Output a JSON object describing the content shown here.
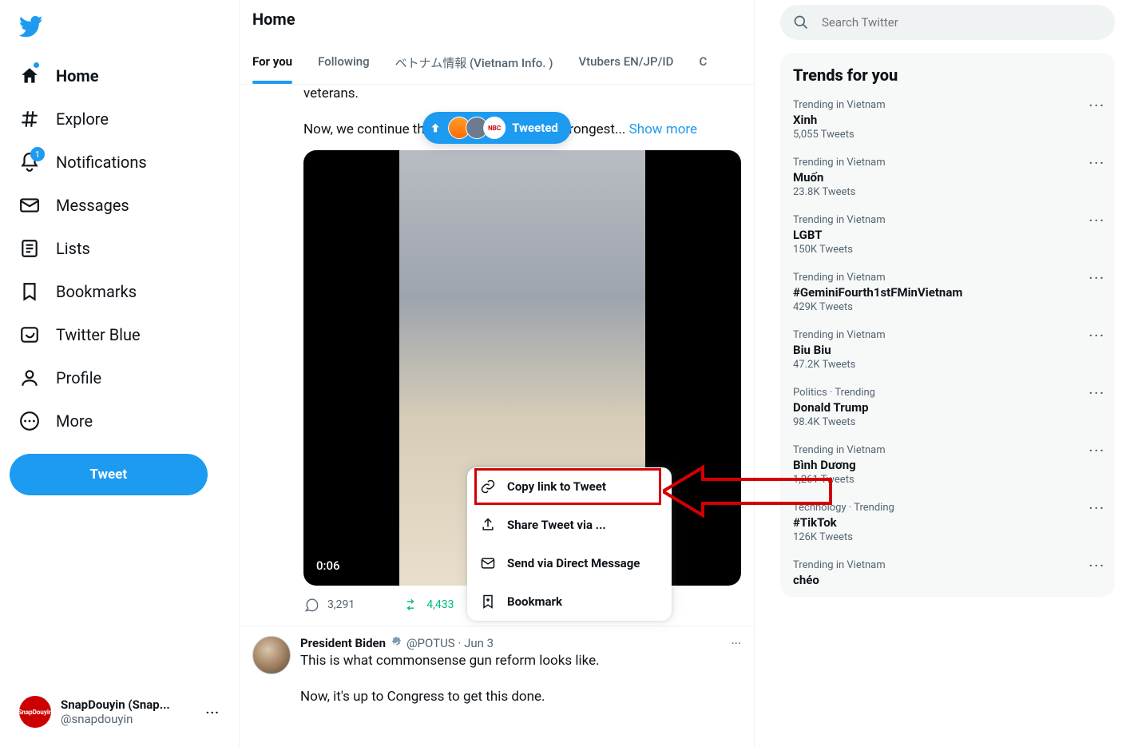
{
  "sidebar": {
    "items": [
      {
        "label": "Home"
      },
      {
        "label": "Explore"
      },
      {
        "label": "Notifications",
        "badge": "1"
      },
      {
        "label": "Messages"
      },
      {
        "label": "Lists"
      },
      {
        "label": "Bookmarks"
      },
      {
        "label": "Twitter Blue"
      },
      {
        "label": "Profile"
      },
      {
        "label": "More"
      }
    ],
    "tweet_button": "Tweet"
  },
  "account": {
    "name": "SnapDouyin (Snap...",
    "handle": "@snapdouyin"
  },
  "main": {
    "title": "Home",
    "tabs": [
      "For you",
      "Following",
      "ベトナム情報 (Vietnam Info. )",
      "Vtubers EN/JP/ID",
      "C"
    ],
    "pill_label": "Tweeted",
    "tweet1": {
      "line1_tail": "veterans.",
      "line2": "Now, we continue the work of building the strongest...",
      "show_more": "Show more",
      "video_time": "0:06",
      "reply_count": "3,291",
      "retweet_count": "4,433"
    },
    "tweet2": {
      "name": "President Biden",
      "handle": "@POTUS",
      "date": "Jun 3",
      "line1": "This is what commonsense gun reform looks like.",
      "line2": "Now, it's up to Congress to get this done."
    }
  },
  "share_menu": {
    "items": [
      "Copy link to Tweet",
      "Share Tweet via ...",
      "Send via Direct Message",
      "Bookmark"
    ]
  },
  "search": {
    "placeholder": "Search Twitter"
  },
  "trends": {
    "title": "Trends for you",
    "items": [
      {
        "ctx": "Trending in Vietnam",
        "name": "Xinh",
        "count": "5,055 Tweets"
      },
      {
        "ctx": "Trending in Vietnam",
        "name": "Muốn",
        "count": "23.8K Tweets"
      },
      {
        "ctx": "Trending in Vietnam",
        "name": "LGBT",
        "count": "150K Tweets"
      },
      {
        "ctx": "Trending in Vietnam",
        "name": "#GeminiFourth1stFMinVietnam",
        "count": "429K Tweets"
      },
      {
        "ctx": "Trending in Vietnam",
        "name": "Biu Biu",
        "count": "47.2K Tweets"
      },
      {
        "ctx": "Politics · Trending",
        "name": "Donald Trump",
        "count": "98.4K Tweets"
      },
      {
        "ctx": "Trending in Vietnam",
        "name": "Bình Dương",
        "count": "1,261 Tweets"
      },
      {
        "ctx": "Technology · Trending",
        "name": "#TikTok",
        "count": "126K Tweets"
      },
      {
        "ctx": "Trending in Vietnam",
        "name": "chéo",
        "count": ""
      }
    ]
  }
}
